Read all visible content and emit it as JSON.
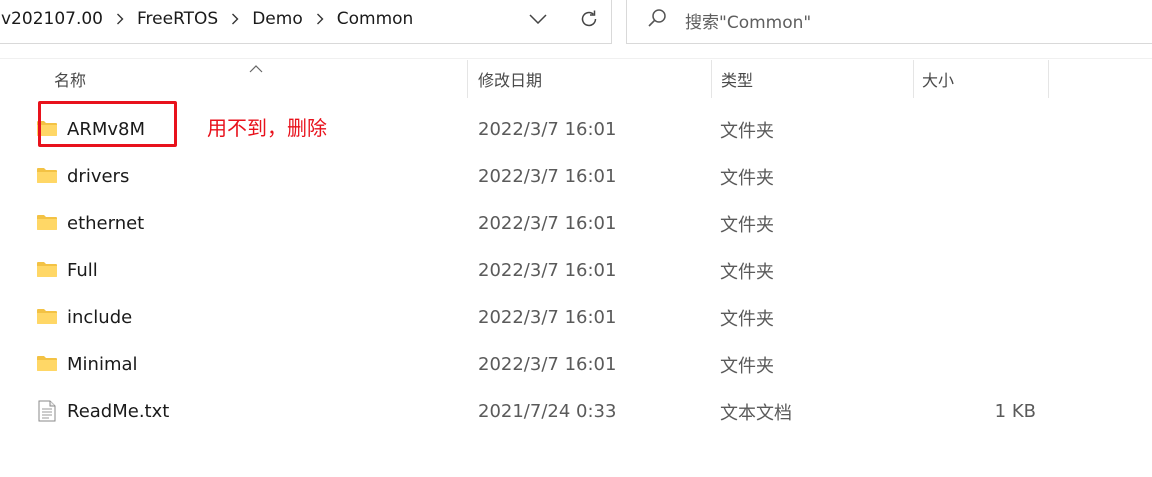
{
  "address_bar": {
    "breadcrumbs": [
      "v202107.00",
      "FreeRTOS",
      "Demo",
      "Common"
    ],
    "dropdown_icon": "chevron-down-icon",
    "refresh_icon": "refresh-icon"
  },
  "search": {
    "placeholder": "搜索\"Common\"",
    "icon": "search-icon"
  },
  "columns": {
    "name": "名称",
    "date_modified": "修改日期",
    "type": "类型",
    "size": "大小"
  },
  "files": [
    {
      "name": "ARMv8M",
      "date": "2022/3/7 16:01",
      "type": "文件夹",
      "size": "",
      "icon": "folder-icon"
    },
    {
      "name": "drivers",
      "date": "2022/3/7 16:01",
      "type": "文件夹",
      "size": "",
      "icon": "folder-icon"
    },
    {
      "name": "ethernet",
      "date": "2022/3/7 16:01",
      "type": "文件夹",
      "size": "",
      "icon": "folder-icon"
    },
    {
      "name": "Full",
      "date": "2022/3/7 16:01",
      "type": "文件夹",
      "size": "",
      "icon": "folder-icon"
    },
    {
      "name": "include",
      "date": "2022/3/7 16:01",
      "type": "文件夹",
      "size": "",
      "icon": "folder-icon"
    },
    {
      "name": "Minimal",
      "date": "2022/3/7 16:01",
      "type": "文件夹",
      "size": "",
      "icon": "folder-icon"
    },
    {
      "name": "ReadMe.txt",
      "date": "2021/7/24 0:33",
      "type": "文本文档",
      "size": "1 KB",
      "icon": "text-file-icon"
    }
  ],
  "annotation": {
    "text": "用不到，删除",
    "color": "#e8121c"
  }
}
